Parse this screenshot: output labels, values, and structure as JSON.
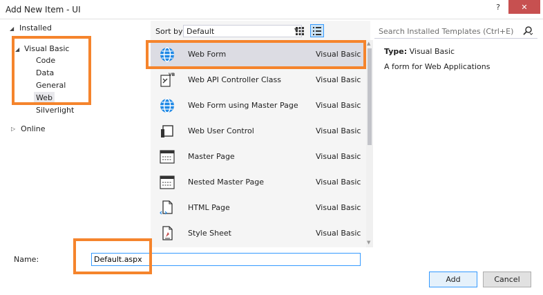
{
  "window": {
    "title": "Add New Item - UI",
    "help_label": "?",
    "close_label": "✕"
  },
  "tree": {
    "installed": "Installed",
    "visual_basic": "Visual Basic",
    "children": [
      "Code",
      "Data",
      "General",
      "Web",
      "Silverlight"
    ],
    "selected": "Web",
    "online": "Online"
  },
  "sort": {
    "label": "Sort by:",
    "value": "Default"
  },
  "templates": [
    {
      "name": "Web Form",
      "lang": "Visual Basic",
      "icon": "globe-icon"
    },
    {
      "name": "Web API Controller Class",
      "lang": "Visual Basic",
      "icon": "vb-class-icon"
    },
    {
      "name": "Web Form using Master Page",
      "lang": "Visual Basic",
      "icon": "globe-icon"
    },
    {
      "name": "Web User Control",
      "lang": "Visual Basic",
      "icon": "user-control-icon"
    },
    {
      "name": "Master Page",
      "lang": "Visual Basic",
      "icon": "master-page-icon"
    },
    {
      "name": "Nested Master Page",
      "lang": "Visual Basic",
      "icon": "master-page-icon"
    },
    {
      "name": "HTML Page",
      "lang": "Visual Basic",
      "icon": "html-page-icon"
    },
    {
      "name": "Style Sheet",
      "lang": "Visual Basic",
      "icon": "style-sheet-icon"
    }
  ],
  "selected_template": "Web Form",
  "search": {
    "placeholder": "Search Installed Templates (Ctrl+E)"
  },
  "details": {
    "type_label": "Type:",
    "type_value": "Visual Basic",
    "description": "A form for Web Applications"
  },
  "name_field": {
    "label": "Name:",
    "value": "Default.aspx"
  },
  "buttons": {
    "add": "Add",
    "cancel": "Cancel"
  },
  "colors": {
    "highlight": "#f5842c",
    "accent": "#3399ff",
    "close": "#c75050"
  }
}
